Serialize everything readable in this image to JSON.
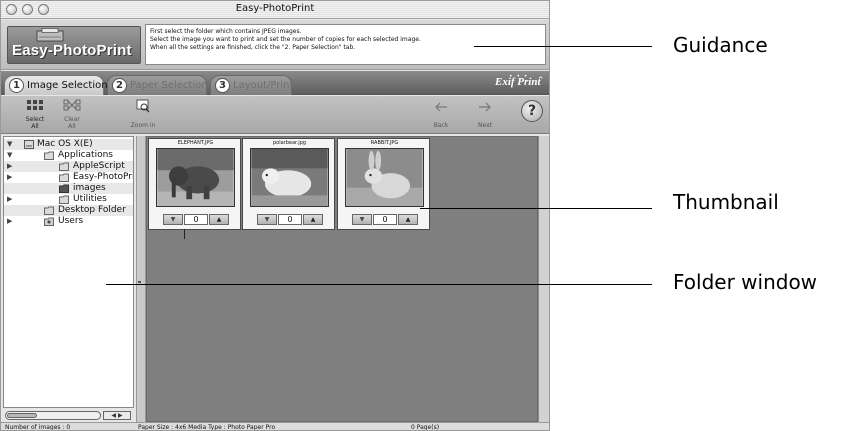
{
  "window": {
    "title": "Easy-PhotoPrint"
  },
  "header": {
    "logo_text": "Easy-PhotoPrint",
    "guidance_lines": [
      "First select the folder which contains JPEG images.",
      "Select the image you want to print and set the number of copies for each selected image.",
      "When all the settings are finished, click the \"2. Paper Selection\" tab."
    ]
  },
  "tabs": [
    {
      "num": "1",
      "label": "Image Selection",
      "active": true
    },
    {
      "num": "2",
      "label": "Paper Selection",
      "active": false
    },
    {
      "num": "3",
      "label": "Layout/Print",
      "active": false
    }
  ],
  "brand": {
    "exif_label": "Exif Print"
  },
  "toolbar": {
    "select_all": [
      "Select",
      "All"
    ],
    "clear_all": [
      "Clear",
      "All"
    ],
    "zoom_in": "Zoom in",
    "back": "Back",
    "next": "Next",
    "help": "?"
  },
  "folder_tree": [
    {
      "label": "Mac OS X(E)",
      "indent": 0,
      "expanded": true,
      "icon": "disk-icon"
    },
    {
      "label": "Applications",
      "indent": 1,
      "expanded": true,
      "icon": "folder-icon"
    },
    {
      "label": "AppleScript",
      "indent": 2,
      "expanded": false,
      "icon": "folder-icon"
    },
    {
      "label": "Easy-PhotoPri",
      "indent": 2,
      "expanded": false,
      "icon": "folder-icon"
    },
    {
      "label": "images",
      "indent": 2,
      "expanded": null,
      "icon": "folder-dark-icon"
    },
    {
      "label": "Utilities",
      "indent": 2,
      "expanded": false,
      "icon": "folder-icon"
    },
    {
      "label": "Desktop Folder",
      "indent": 1,
      "expanded": null,
      "icon": "folder-icon"
    },
    {
      "label": "Users",
      "indent": 1,
      "expanded": false,
      "icon": "users-folder-icon"
    }
  ],
  "thumbnails": [
    {
      "filename": "ELEPHANT.JPG",
      "copies": "0"
    },
    {
      "filename": "polarbear.jpg",
      "copies": "0"
    },
    {
      "filename": "RABBIT.JPG",
      "copies": "0"
    }
  ],
  "status": {
    "count": "Number of images : 0",
    "paper": "Paper Size : 4x6 Media Type : Photo Paper Pro",
    "pages": "0 Page(s)"
  },
  "callouts": {
    "guidance": "Guidance",
    "thumbnail": "Thumbnail",
    "folder": "Folder window"
  },
  "colors": {
    "content_bg": "#7f7f7f",
    "tabstrip_bg": "#6e6e6e",
    "folder_bg": "#ffffff"
  }
}
